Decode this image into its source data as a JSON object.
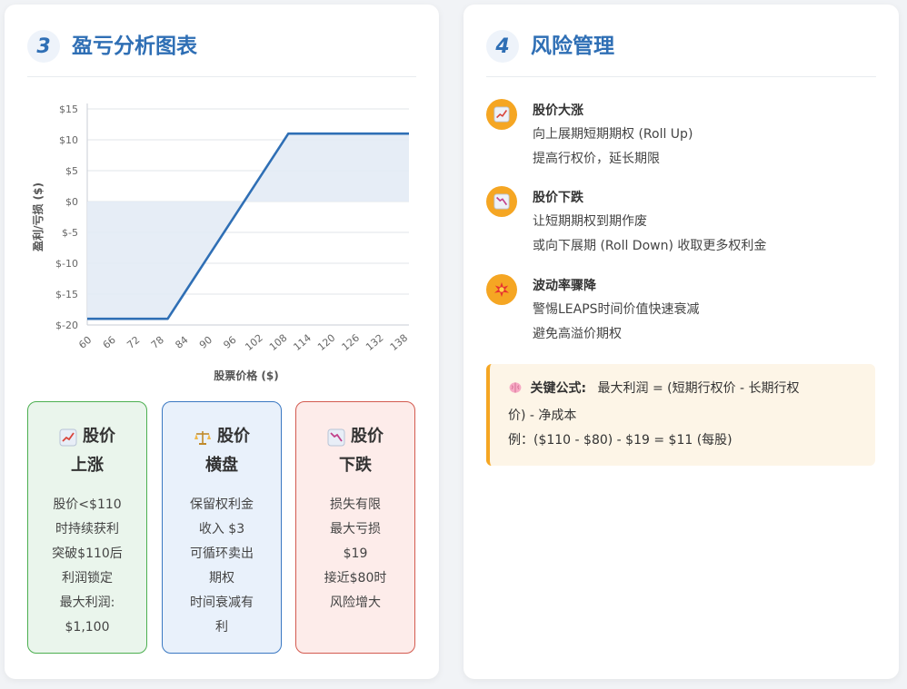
{
  "left_card": {
    "number": "3",
    "title": "盈亏分析图表"
  },
  "chart_data": {
    "type": "line",
    "title": "",
    "xlabel": "股票价格 ($)",
    "ylabel": "盈利/亏损 ($)",
    "x": [
      60,
      66,
      72,
      78,
      80,
      84,
      90,
      96,
      102,
      108,
      110,
      114,
      120,
      126,
      132,
      138,
      140
    ],
    "y": [
      -19,
      -19,
      -19,
      -19,
      -19,
      -15,
      -9,
      -3,
      3,
      9,
      11,
      11,
      11,
      11,
      11,
      11,
      11
    ],
    "xticks": [
      60,
      66,
      72,
      78,
      84,
      90,
      96,
      102,
      108,
      114,
      120,
      126,
      132,
      138
    ],
    "yticks": [
      15,
      10,
      5,
      0,
      -5,
      -10,
      -15,
      -20
    ],
    "ytick_labels": [
      "$15",
      "$10",
      "$5",
      "$0",
      "$-5",
      "$-10",
      "$-15",
      "$-20"
    ],
    "xlim": [
      60,
      140
    ],
    "ylim": [
      -20,
      15
    ],
    "grid": true,
    "fill": true,
    "colors": {
      "line": "#2f6fb5",
      "fill": "#e3ebf5"
    }
  },
  "scenarios": [
    {
      "icon": "chart-up-icon",
      "title1": "股价",
      "title2": "上涨",
      "lines": [
        "股价<$110",
        "时持续获利",
        "突破$110后",
        "利润锁定",
        "最大利润:",
        "$1,100"
      ]
    },
    {
      "icon": "balance-scale-icon",
      "title1": "股价",
      "title2": "横盘",
      "lines": [
        "保留权利金",
        "收入 $3",
        "可循环卖出",
        "期权",
        "时间衰减有",
        "利"
      ]
    },
    {
      "icon": "chart-down-icon",
      "title1": "股价",
      "title2": "下跌",
      "lines": [
        "损失有限",
        "最大亏损",
        "$19",
        "接近$80时",
        "风险增大"
      ]
    }
  ],
  "right_card": {
    "number": "4",
    "title": "风险管理",
    "items": [
      {
        "icon": "chart-up-icon",
        "title": "股价大涨",
        "lines": [
          "向上展期短期期权 (Roll Up)",
          "提高行权价，延长期限"
        ]
      },
      {
        "icon": "chart-down-icon",
        "title": "股价下跌",
        "lines": [
          "让短期期权到期作废",
          "或向下展期 (Roll Down) 收取更多权利金"
        ]
      },
      {
        "icon": "collision-icon",
        "title": "波动率骤降",
        "lines": [
          "警惕LEAPS时间价值快速衰减",
          "避免高溢价期权"
        ]
      }
    ],
    "formula": {
      "icon": "brain-icon",
      "label": "关键公式:",
      "text": "最大利润 = (短期行权价 - 长期行权",
      "text2": "价) - 净成本",
      "example": "例：($110 - $80) - $19 = $11 (每股)"
    }
  }
}
